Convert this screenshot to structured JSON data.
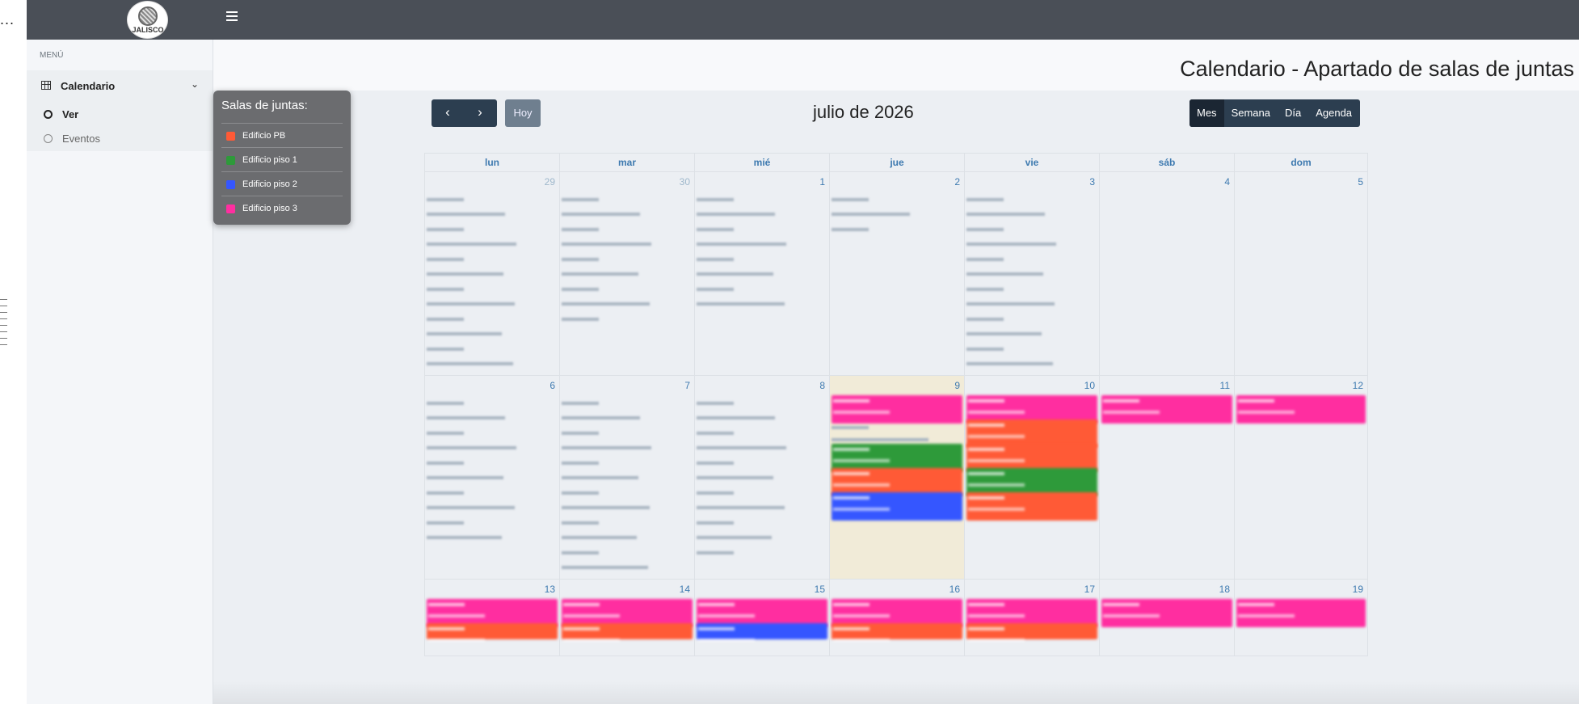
{
  "header": {
    "dots": "...",
    "logo_text": "JALISCO"
  },
  "sidebar": {
    "menu_title": "MENÚ",
    "calendar_label": "Calendario",
    "items": [
      {
        "label": "Ver",
        "active": true
      },
      {
        "label": "Eventos",
        "active": false
      }
    ]
  },
  "page": {
    "title": "Calendario - Apartado de salas de juntas"
  },
  "legend": {
    "title": "Salas de juntas:",
    "rooms": [
      {
        "label": "Edificio PB",
        "color": "#ff5a36"
      },
      {
        "label": "Edificio piso 1",
        "color": "#2e9a3a"
      },
      {
        "label": "Edificio piso 2",
        "color": "#3556ff"
      },
      {
        "label": "Edificio piso 3",
        "color": "#ff2ea0"
      }
    ]
  },
  "toolbar": {
    "prev": "‹",
    "next": "›",
    "today": "Hoy",
    "title": "julio de 2026",
    "views": [
      "Mes",
      "Semana",
      "Día",
      "Agenda"
    ],
    "active_view": "Mes"
  },
  "calendar": {
    "weekdays": [
      "lun",
      "mar",
      "mié",
      "jue",
      "vie",
      "sáb",
      "dom"
    ],
    "weeks": [
      [
        "29",
        "30",
        "1",
        "2",
        "3",
        "4",
        "5"
      ],
      [
        "6",
        "7",
        "8",
        "9",
        "10",
        "11",
        "12"
      ],
      [
        "13",
        "14",
        "15",
        "16",
        "17",
        "18",
        "19"
      ]
    ],
    "today": "9"
  }
}
